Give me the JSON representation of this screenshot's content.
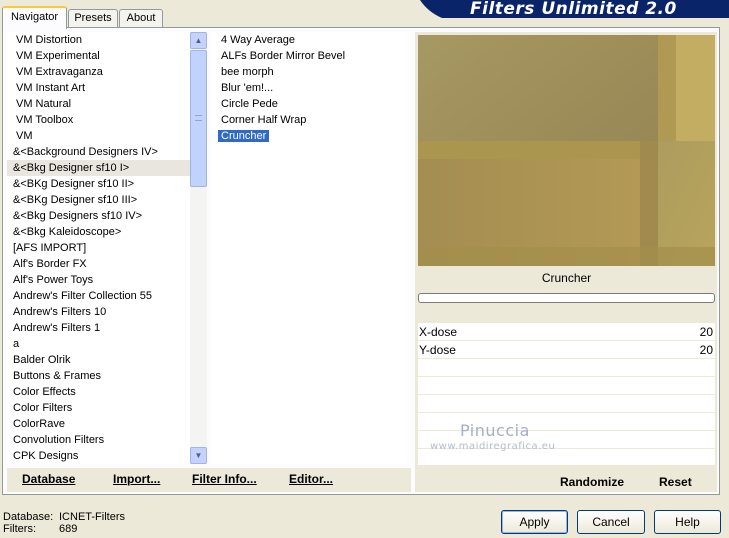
{
  "tabs": [
    {
      "label": "Navigator",
      "active": true
    },
    {
      "label": "Presets",
      "active": false
    },
    {
      "label": "About",
      "active": false
    }
  ],
  "banner": {
    "title": "Filters Unlimited 2.0"
  },
  "categories": [
    "VM Distortion",
    "VM Experimental",
    "VM Extravaganza",
    "VM Instant Art",
    "VM Natural",
    "VM Toolbox",
    "VM",
    "&<Background Designers IV>",
    "&<Bkg Designer sf10 I>",
    "&<BKg Designer sf10 II>",
    "&<BKg Designer sf10 III>",
    "&<Bkg Designers sf10 IV>",
    "&<Bkg Kaleidoscope>",
    "[AFS IMPORT]",
    "Alf's Border FX",
    "Alf's Power Toys",
    "Andrew's Filter Collection 55",
    "Andrew's Filters 10",
    "Andrew's Filters 1",
    "a",
    "Balder Olrik",
    "Buttons & Frames",
    "Color Effects",
    "Color Filters",
    "ColorRave",
    "Convolution Filters",
    "CPK Designs"
  ],
  "selected_category": "&<Bkg Designer sf10 I>",
  "filters": [
    "4 Way Average",
    "ALFs Border Mirror Bevel",
    "bee morph",
    "Blur 'em!...",
    "Circle Pede",
    "Corner Half Wrap",
    "Cruncher"
  ],
  "selected_filter": "Cruncher",
  "bottom_buttons": {
    "database": "Database",
    "import": "Import...",
    "filter_info": "Filter Info...",
    "editor": "Editor..."
  },
  "preview": {
    "filter_name": "Cruncher"
  },
  "params": [
    {
      "name": "X-dose",
      "value": "20"
    },
    {
      "name": "Y-dose",
      "value": "20"
    }
  ],
  "watermark": {
    "line1": "Pinuccia",
    "line2": "www.maidiregrafica.eu"
  },
  "right_buttons": {
    "randomize": "Randomize",
    "reset": "Reset"
  },
  "status": {
    "database_label": "Database:",
    "database_value": "ICNET-Filters",
    "filters_label": "Filters:",
    "filters_value": "689"
  },
  "dialog_buttons": {
    "apply": "Apply",
    "cancel": "Cancel",
    "help": "Help"
  },
  "colors": {
    "selection": "#316ac5",
    "banner": "#0a246a",
    "tab_highlight": "#ffc83c"
  }
}
